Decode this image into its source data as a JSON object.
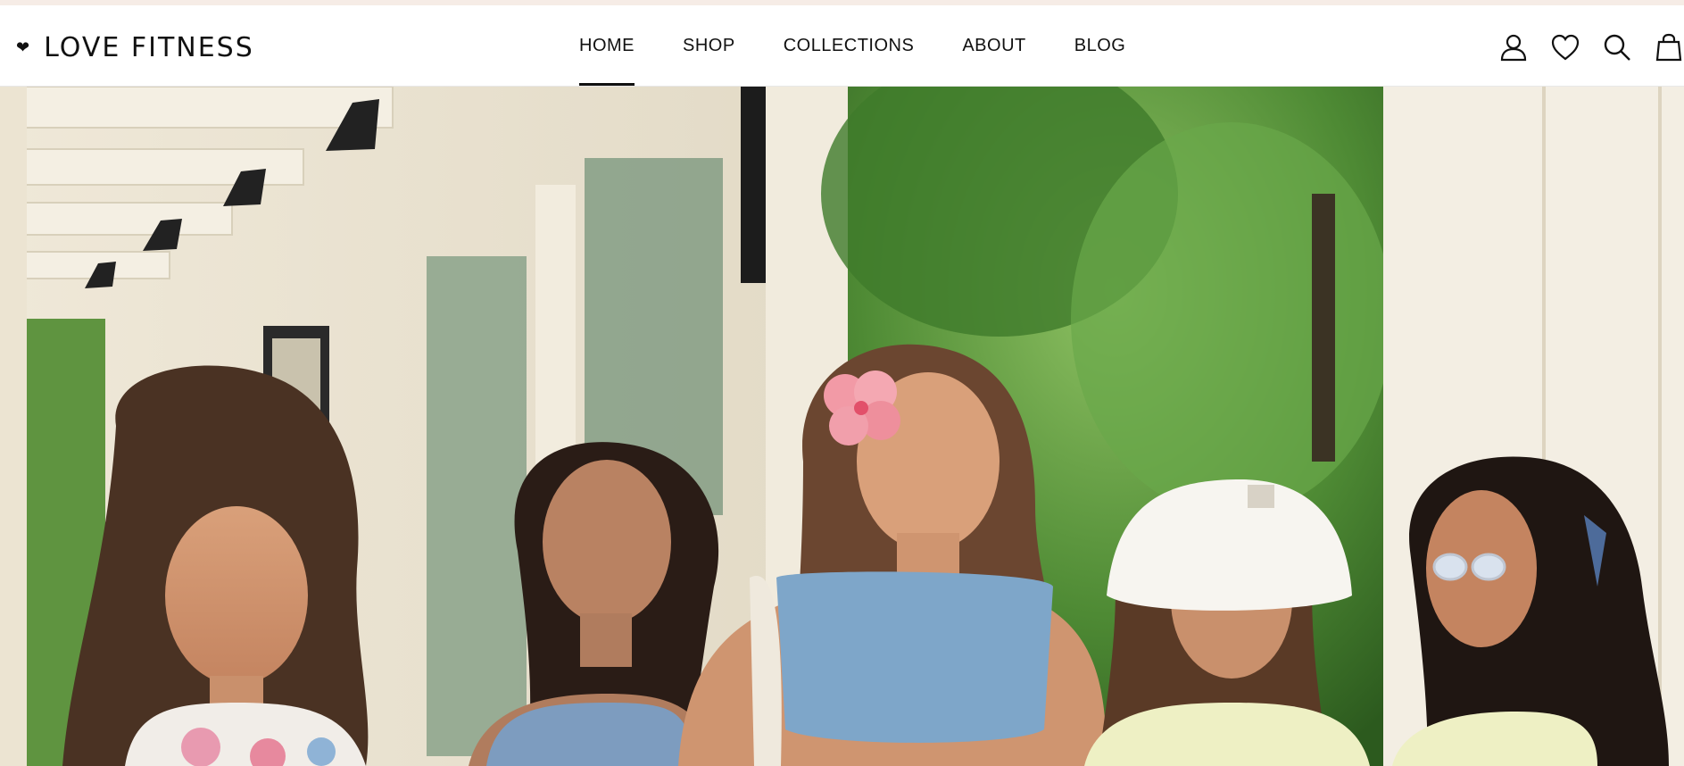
{
  "brand": {
    "heart": "❤",
    "name": "LOVE FITNESS"
  },
  "nav": {
    "items": [
      {
        "label": "HOME",
        "active": true
      },
      {
        "label": "SHOP",
        "active": false
      },
      {
        "label": "COLLECTIONS",
        "active": false
      },
      {
        "label": "ABOUT",
        "active": false
      },
      {
        "label": "BLOG",
        "active": false
      }
    ]
  },
  "header_icons": [
    "account-icon",
    "wishlist-heart-icon",
    "search-icon",
    "cart-bag-icon"
  ],
  "hero": {
    "image_alt": "Five women in sports bras and tank tops posing outdoors by a white building and trees",
    "colors": {
      "sky_tint": "#f6ece6",
      "accent": "#111111"
    }
  }
}
